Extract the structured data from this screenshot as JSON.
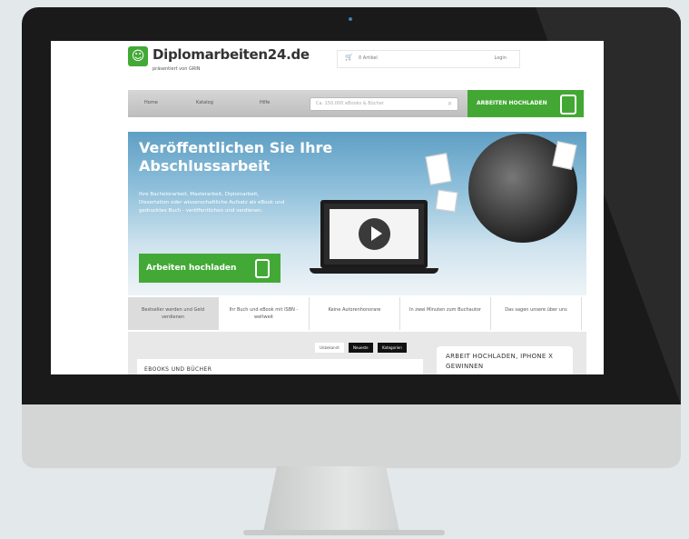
{
  "site": {
    "logo": "Diplomarbeiten24.de",
    "logo_sub": "präsentiert von GRIN",
    "cart_text": "0 Artikel",
    "login": "Login",
    "nav": [
      "Home",
      "Katalog",
      "Hilfe"
    ],
    "search_placeholder": "Ca. 150.000 eBooks & Bücher",
    "upload_label": "ARBEITEN HOCHLADEN"
  },
  "hero": {
    "title": "Veröffentlichen Sie Ihre Abschlussarbeit",
    "text": "Ihre Bachelorarbeit, Masterarbeit, Diplomarbeit, Dissertation oder wissenschaftliche Aufsatz als eBook und gedrucktes Buch - veröffentlichen und verdienen.",
    "cta": "Arbeiten hochladen"
  },
  "tabs": [
    "Bestseller werden und Geld verdienen",
    "Ihr Buch und eBook mit ISBN - weltweit",
    "Keine Autorenhonorare",
    "In zwei Minuten zum Buchautor",
    "Das sagen unsere über uns"
  ],
  "filters": [
    "Unbekannt",
    "Neueste",
    "Kategorien"
  ],
  "sections": {
    "books_title": "EBOOKS UND BÜCHER",
    "promo_title": "ARBEIT HOCHLADEN, IPHONE X GEWINNEN"
  },
  "colors": {
    "brand_green": "#43a936",
    "hero_sky": "#5f9fc4",
    "bezel": "#1a1a1b"
  }
}
